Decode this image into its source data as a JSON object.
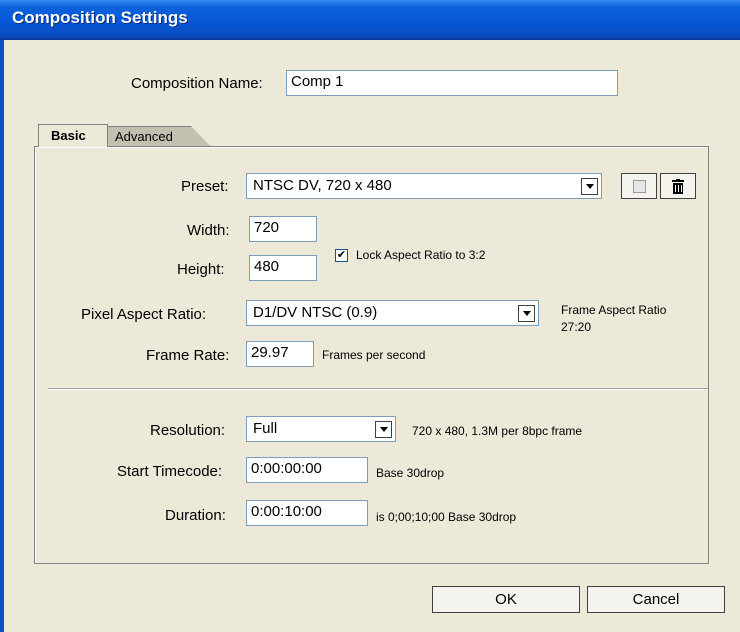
{
  "window": {
    "title": "Composition Settings"
  },
  "comp_name": {
    "label": "Composition Name:",
    "value": "Comp 1"
  },
  "tabs": [
    {
      "label": "Basic"
    },
    {
      "label": "Advanced"
    }
  ],
  "basic": {
    "preset_label": "Preset:",
    "preset_value": "NTSC DV, 720 x 480",
    "width_label": "Width:",
    "width_value": "720",
    "height_label": "Height:",
    "height_value": "480",
    "lock_label": "Lock Aspect Ratio to 3:2",
    "lock_checked": true,
    "par_label": "Pixel Aspect Ratio:",
    "par_value": "D1/DV NTSC (0.9)",
    "frame_aspect_label": "Frame Aspect Ratio",
    "frame_aspect_value": "27:20",
    "frame_rate_label": "Frame Rate:",
    "frame_rate_value": "29.97",
    "frame_rate_unit": "Frames per second",
    "resolution_label": "Resolution:",
    "resolution_value": "Full",
    "resolution_info": "720 x 480, 1.3M per 8bpc frame",
    "start_tc_label": "Start Timecode:",
    "start_tc_value": "0:00:00:00",
    "start_tc_base": "Base 30drop",
    "duration_label": "Duration:",
    "duration_value": "0:00:10:00",
    "duration_info": "is 0;00;10;00  Base 30drop"
  },
  "buttons": {
    "ok": "OK",
    "cancel": "Cancel"
  },
  "icons": [
    "save-preset-icon",
    "trash-icon",
    "checkmark-icon",
    "chevron-down-icon"
  ]
}
